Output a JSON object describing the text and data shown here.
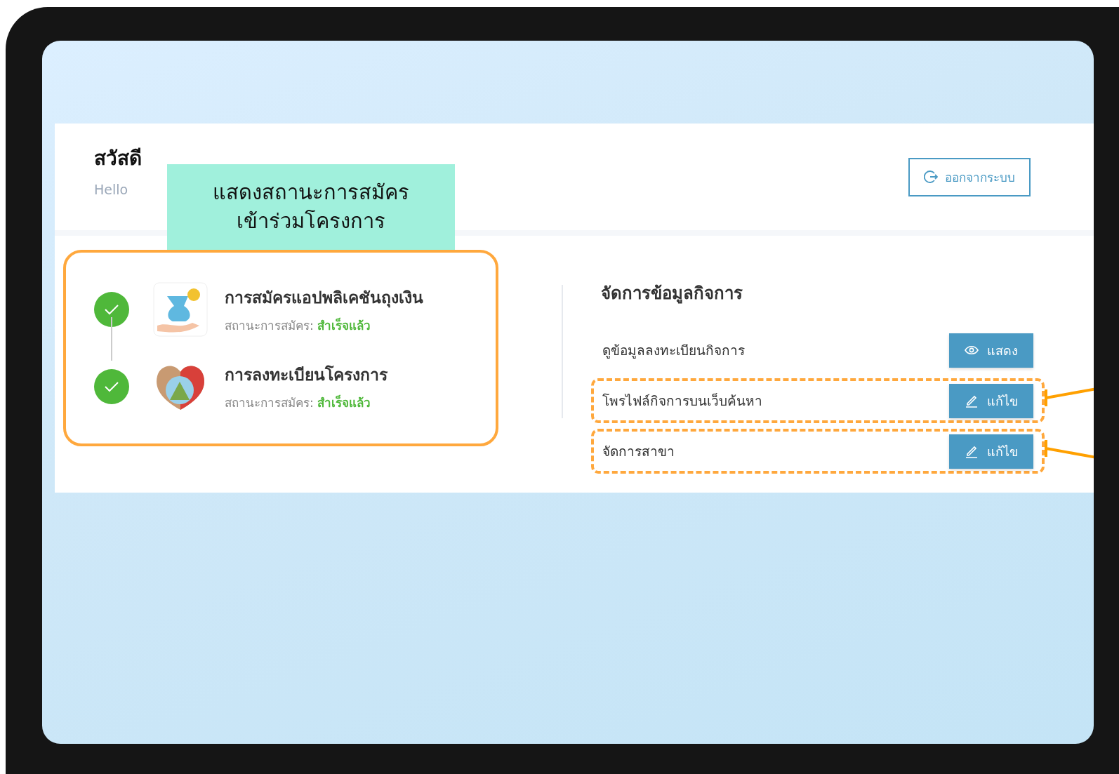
{
  "greeting": {
    "title": "สวัสดี",
    "subtitle": "Hello"
  },
  "logout_button": {
    "label": "ออกจากระบบ"
  },
  "callout": {
    "lines": [
      "แสดงสถานะการสมัคร",
      "เข้าร่วมโครงการ"
    ]
  },
  "steps": [
    {
      "title": "การสมัครแอปพลิเคชันถุงเงิน",
      "status_label": "สถานะการสมัคร:",
      "status_value": "สำเร็จแล้ว",
      "done": true
    },
    {
      "title": "การลงทะเบียนโครงการ",
      "status_label": "สถานะการสมัคร:",
      "status_value": "สำเร็จแล้ว",
      "done": true
    }
  ],
  "manage": {
    "title": "จัดการข้อมูลกิจการ",
    "items": [
      {
        "label": "ดูข้อมูลลงทะเบียนกิจการ",
        "button": {
          "kind": "view",
          "label": "แสดง"
        }
      },
      {
        "label": "โพรไฟล์กิจการบนเว็บค้นหา",
        "button": {
          "kind": "edit",
          "label": "แก้ไข"
        },
        "highlighted": true
      },
      {
        "label": "จัดการสาขา",
        "button": {
          "kind": "edit",
          "label": "แก้ไข"
        },
        "highlighted": true
      }
    ]
  }
}
